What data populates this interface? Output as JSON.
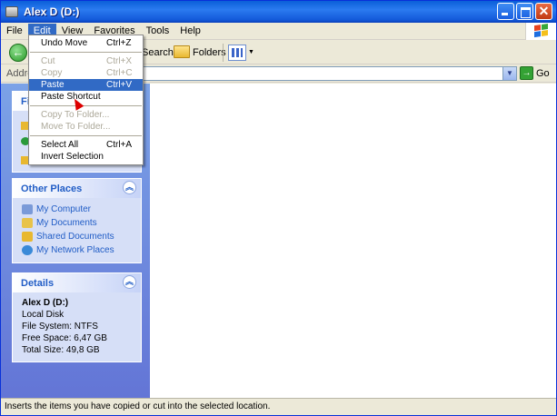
{
  "window": {
    "title": "Alex D (D:)"
  },
  "menubar": {
    "items": [
      "File",
      "Edit",
      "View",
      "Favorites",
      "Tools",
      "Help"
    ]
  },
  "toolbar": {
    "back_icon": "back-arrow-icon",
    "search_label": "Search",
    "folders_label": "Folders",
    "views_icon": "views-icon"
  },
  "address": {
    "label": "Addre",
    "value": "",
    "go_label": "Go"
  },
  "edit_menu": {
    "items": [
      {
        "label": "Undo Move",
        "shortcut": "Ctrl+Z",
        "enabled": true
      },
      {
        "label": "Cut",
        "shortcut": "Ctrl+X",
        "enabled": false
      },
      {
        "label": "Copy",
        "shortcut": "Ctrl+C",
        "enabled": false
      },
      {
        "label": "Paste",
        "shortcut": "Ctrl+V",
        "enabled": true,
        "highlighted": true
      },
      {
        "label": "Paste Shortcut",
        "shortcut": "",
        "enabled": true
      },
      {
        "label": "Copy To Folder...",
        "shortcut": "",
        "enabled": false
      },
      {
        "label": "Move To Folder...",
        "shortcut": "",
        "enabled": false
      },
      {
        "label": "Select All",
        "shortcut": "Ctrl+A",
        "enabled": true
      },
      {
        "label": "Invert Selection",
        "shortcut": "",
        "enabled": true
      }
    ]
  },
  "left_panel": {
    "tasks_title": "Fi",
    "other_places": {
      "title": "Other Places",
      "links": [
        "My Computer",
        "My Documents",
        "Shared Documents",
        "My Network Places"
      ]
    },
    "details": {
      "title": "Details",
      "name": "Alex D (D:)",
      "type": "Local Disk",
      "file_system": "File System: NTFS",
      "free_space": "Free Space: 6,47 GB",
      "total_size": "Total Size: 49,8 GB"
    }
  },
  "statusbar": {
    "text": "Inserts the items you have copied or cut into the selected location."
  },
  "colors": {
    "titlebar": "#0a5fd8",
    "menu_highlight": "#316ac5",
    "panel_link": "#215dc6",
    "panel_bg": "#6375d6"
  }
}
